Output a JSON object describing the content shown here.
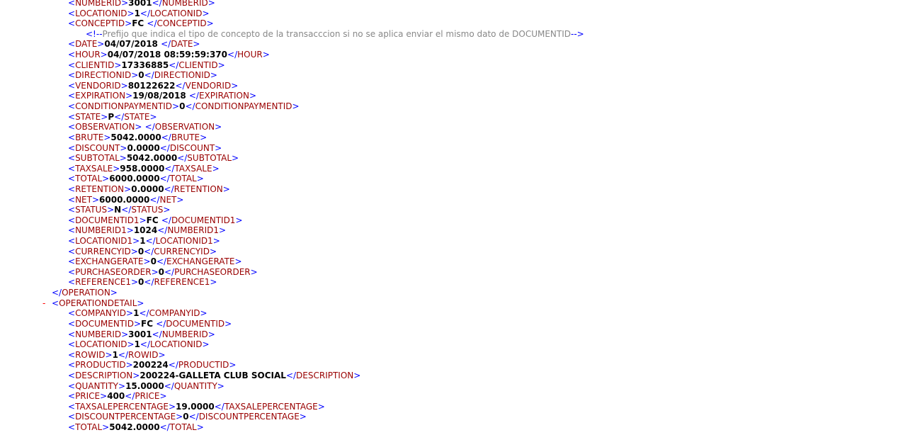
{
  "collapse_marker": "-",
  "before_lines": [
    {
      "tag": "NUMBERID",
      "value": "3001"
    },
    {
      "tag": "LOCATIONID",
      "value": "1"
    },
    {
      "tag": "CONCEPTID",
      "value": "FC "
    }
  ],
  "comment": "Prefijo que indica el tipo de concepto de la transacccion si no se aplica enviar el mismo dato de DOCUMENTID",
  "after_lines": [
    {
      "tag": "DATE",
      "value": "04/07/2018 "
    },
    {
      "tag": "HOUR",
      "value": "04/07/2018 08:59:59:370"
    },
    {
      "tag": "CLIENTID",
      "value": "17336885"
    },
    {
      "tag": "DIRECTIONID",
      "value": "0"
    },
    {
      "tag": "VENDORID",
      "value": "80122622"
    },
    {
      "tag": "EXPIRATION",
      "value": "19/08/2018 "
    },
    {
      "tag": "CONDITIONPAYMENTID",
      "value": "0"
    },
    {
      "tag": "STATE",
      "value": "P"
    },
    {
      "tag": "OBSERVATION",
      "value": " "
    },
    {
      "tag": "BRUTE",
      "value": "5042.0000"
    },
    {
      "tag": "DISCOUNT",
      "value": "0.0000"
    },
    {
      "tag": "SUBTOTAL",
      "value": "5042.0000"
    },
    {
      "tag": "TAXSALE",
      "value": "958.0000"
    },
    {
      "tag": "TOTAL",
      "value": "6000.0000"
    },
    {
      "tag": "RETENTION",
      "value": "0.0000"
    },
    {
      "tag": "NET",
      "value": "6000.0000"
    },
    {
      "tag": "STATUS",
      "value": "N"
    },
    {
      "tag": "DOCUMENTID1",
      "value": "FC "
    },
    {
      "tag": "NUMBERID1",
      "value": "1024"
    },
    {
      "tag": "LOCATIONID1",
      "value": "1"
    },
    {
      "tag": "CURRENCYID",
      "value": "0"
    },
    {
      "tag": "EXCHANGERATE",
      "value": "0"
    },
    {
      "tag": "PURCHASEORDER",
      "value": "0"
    },
    {
      "tag": "REFERENCE1",
      "value": "0"
    }
  ],
  "operation_close_tag": "OPERATION",
  "detail_open_tag": "OPERATIONDETAIL",
  "detail_lines": [
    {
      "tag": "COMPANYID",
      "value": "1"
    },
    {
      "tag": "DOCUMENTID",
      "value": "FC "
    },
    {
      "tag": "NUMBERID",
      "value": "3001"
    },
    {
      "tag": "LOCATIONID",
      "value": "1"
    },
    {
      "tag": "ROWID",
      "value": "1"
    },
    {
      "tag": "PRODUCTID",
      "value": "200224"
    },
    {
      "tag": "DESCRIPTION",
      "value": "200224-GALLETA CLUB SOCIAL"
    },
    {
      "tag": "QUANTITY",
      "value": "15.0000"
    },
    {
      "tag": "PRICE",
      "value": "400"
    },
    {
      "tag": "TAXSALEPERCENTAGE",
      "value": "19.0000"
    },
    {
      "tag": "DISCOUNTPERCENTAGE",
      "value": "0"
    },
    {
      "tag": "TOTAL",
      "value": "5042.0000"
    }
  ]
}
